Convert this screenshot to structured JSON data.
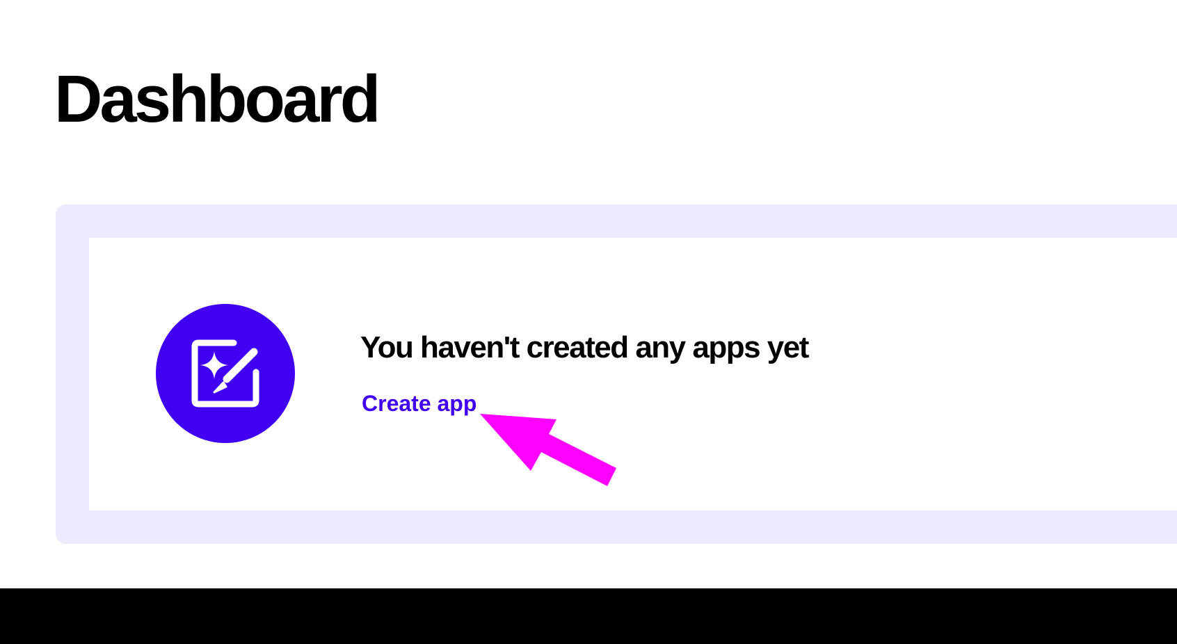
{
  "page": {
    "title": "Dashboard"
  },
  "empty_state": {
    "icon": "pencil-sparkle-icon",
    "heading": "You haven't created any apps yet",
    "create_link_label": "Create app"
  },
  "annotation": {
    "icon": "arrow-pointer",
    "color": "#ff00ff"
  },
  "colors": {
    "accent": "#4100f4",
    "panel_background": "#eeeafd",
    "bottom_bar": "#000000"
  }
}
